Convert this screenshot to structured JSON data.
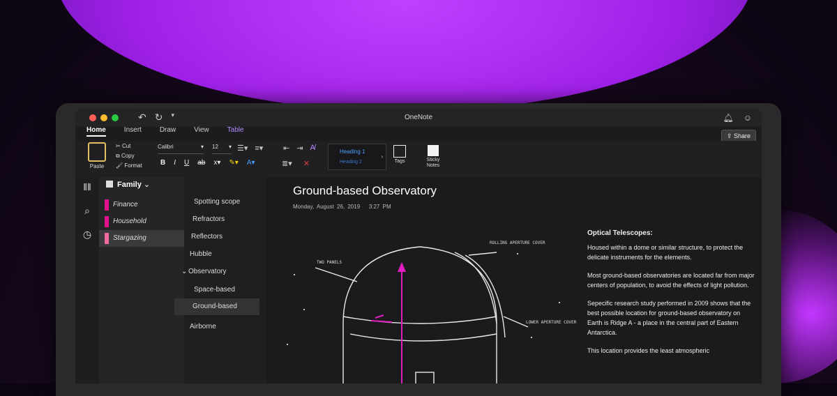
{
  "window": {
    "title": "OneNote"
  },
  "header": {
    "share_label": "Share"
  },
  "ribbon": {
    "tabs": [
      {
        "label": "Home",
        "active": true
      },
      {
        "label": "Insert"
      },
      {
        "label": "Draw"
      },
      {
        "label": "View"
      },
      {
        "label": "Table"
      }
    ],
    "paste_label": "Paste",
    "cut_label": "Cut",
    "copy_label": "Copy",
    "format_label": "Format",
    "font": "Calibri",
    "font_size": "12",
    "style_heading1": "Heading 1",
    "style_heading2": "Heading 2",
    "tags_label": "Tags",
    "sticky_notes_label": "Sticky Notes"
  },
  "notebook": {
    "name": "Family"
  },
  "sections": [
    {
      "label": "Finance"
    },
    {
      "label": "Household"
    },
    {
      "label": "Stargazing",
      "selected": true
    }
  ],
  "pages": [
    {
      "label": "Spotting scope",
      "indent": 1
    },
    {
      "label": "Refractors",
      "indent": 1
    },
    {
      "label": "Reflectors",
      "indent": 1
    },
    {
      "label": "Hubble",
      "indent": 0
    },
    {
      "label": "Observatory",
      "indent": 0,
      "expanded": true
    },
    {
      "label": "Space-based",
      "indent": 1
    },
    {
      "label": "Ground-based",
      "indent": 1,
      "selected": true
    },
    {
      "label": "Airborne",
      "indent": 1
    }
  ],
  "page": {
    "title": "Ground-based Observatory",
    "date": "Monday, August 26, 2019",
    "time": "3:27 PM",
    "notes_heading": "Optical Telescopes:",
    "paragraphs": [
      "Housed within a dome or similar structure, to protect the delicate instruments for the elements.",
      "Most ground-based observatories are located far from major centers of population, to avoid the effects of light pollution.",
      "Sepecific research study performed in 2009 shows that the best possible location for ground-based observatory on Earth is Ridge A - a place in the central part of Eastern Antarctica.",
      "This location provides the least atmospheric"
    ],
    "sketch_labels": [
      "TWO PANELS",
      "ROLLING APERTURE COVER",
      "LOWER APERTURE COVER"
    ]
  },
  "colors": {
    "accent": "#e0128c",
    "table_tab": "#b48cff",
    "heading_blue": "#4aa0ff"
  }
}
